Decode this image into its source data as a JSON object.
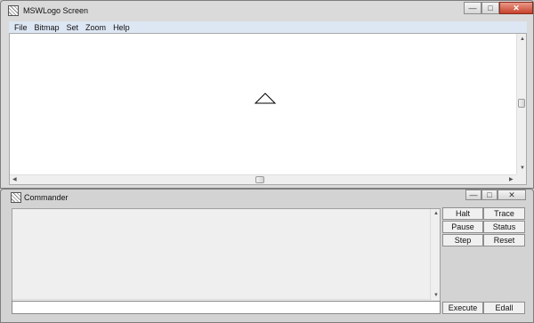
{
  "screen_window": {
    "title": "MSWLogo Screen",
    "menu": [
      "File",
      "Bitmap",
      "Set",
      "Zoom",
      "Help"
    ],
    "controls": {
      "minimize": "—",
      "maximize": "□",
      "close": "✕"
    }
  },
  "commander_window": {
    "title": "Commander",
    "controls": {
      "minimize": "—",
      "maximize": "□",
      "close": "✕"
    },
    "buttons": {
      "halt": "Halt",
      "trace": "Trace",
      "pause": "Pause",
      "status": "Status",
      "step": "Step",
      "reset": "Reset",
      "execute": "Execute",
      "edall": "Edall"
    },
    "input_value": ""
  },
  "icons": {
    "app": "mswlogo-app-icon",
    "turtle": "turtle-triangle-icon",
    "scroll_up": "▲",
    "scroll_down": "▼",
    "scroll_left": "◀",
    "scroll_right": "▶"
  }
}
